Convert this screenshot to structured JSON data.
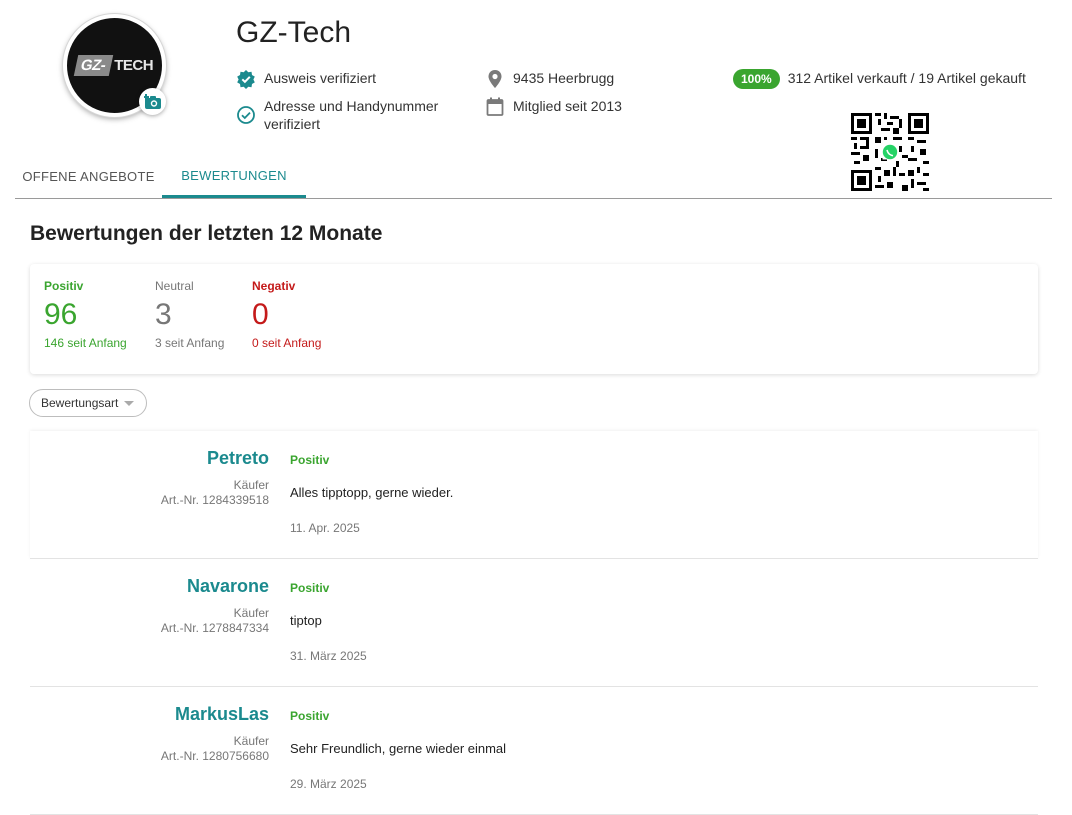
{
  "profile": {
    "name": "GZ-Tech",
    "logo_text_a": "GZ-",
    "logo_text_b": "TECH",
    "id_verified": "Ausweis verifiziert",
    "address_verified": "Adresse und Handynummer verifiziert",
    "location": "9435 Heerbrugg",
    "member_since": "Mitglied seit 2013",
    "success_rate": "100%",
    "sales_stats": "312 Artikel verkauft / 19 Artikel gekauft"
  },
  "tabs": [
    {
      "label": "OFFENE ANGEBOTE",
      "active": false
    },
    {
      "label": "BEWERTUNGEN",
      "active": true
    }
  ],
  "ratings": {
    "title": "Bewertungen der letzten 12 Monate",
    "positive": {
      "label": "Positiv",
      "value": "96",
      "since": "146 seit Anfang"
    },
    "neutral": {
      "label": "Neutral",
      "value": "3",
      "since": "3 seit Anfang"
    },
    "negative": {
      "label": "Negativ",
      "value": "0",
      "since": "0 seit Anfang"
    }
  },
  "filter": {
    "label": "Bewertungsart"
  },
  "reviews": [
    {
      "user": "Petreto",
      "role": "Käufer",
      "article": "Art.-Nr. 1284339518",
      "type": "Positiv",
      "text": "Alles tipptopp, gerne wieder.",
      "date": "11. Apr. 2025"
    },
    {
      "user": "Navarone",
      "role": "Käufer",
      "article": "Art.-Nr. 1278847334",
      "type": "Positiv",
      "text": "tiptop",
      "date": "31. März 2025"
    },
    {
      "user": "MarkusLas",
      "role": "Käufer",
      "article": "Art.-Nr. 1280756680",
      "type": "Positiv",
      "text": "Sehr Freundlich, gerne wieder einmal",
      "date": "29. März 2025"
    }
  ],
  "colors": {
    "accent": "#1b8a8e",
    "positive": "#3aa52f",
    "neutral": "#777777",
    "negative": "#c41a1a"
  },
  "icons": {
    "camera": "camera-add-icon",
    "verified_badge": "verified-badge-icon",
    "check_circle": "check-circle-icon",
    "location": "location-pin-icon",
    "calendar": "calendar-icon",
    "qr": "qr-code-icon",
    "whatsapp": "whatsapp-icon"
  }
}
